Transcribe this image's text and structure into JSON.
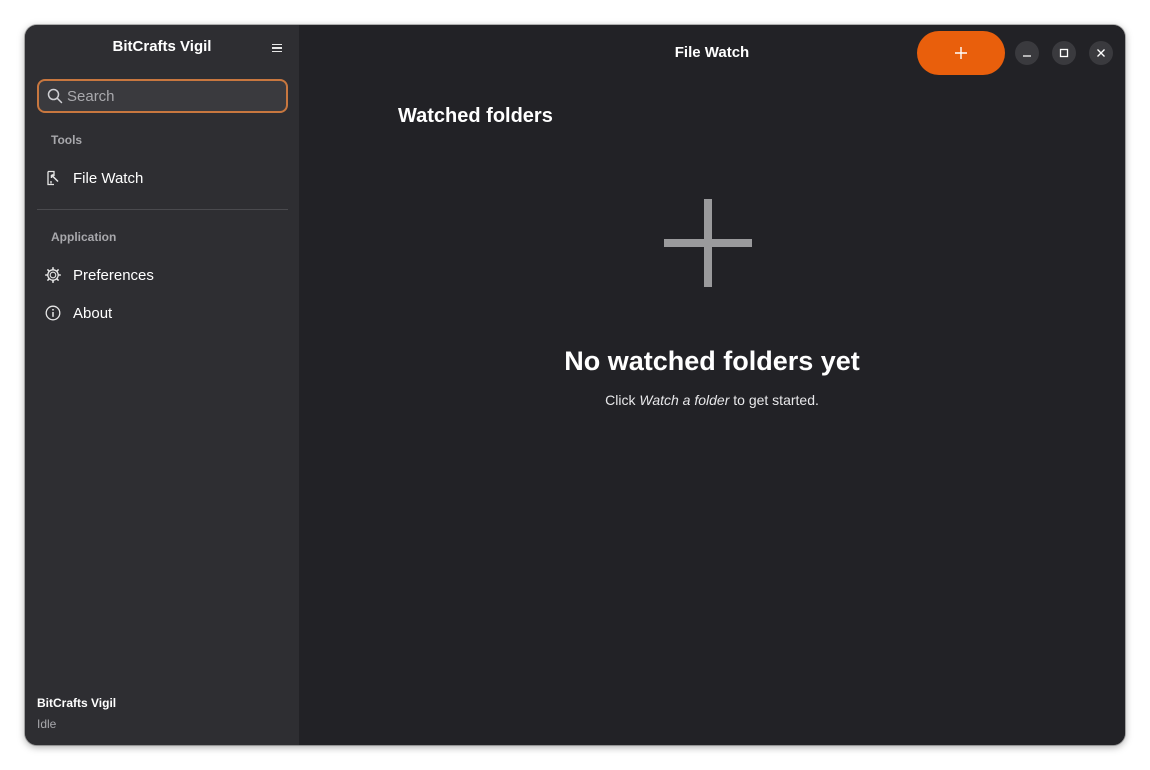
{
  "sidebar": {
    "title": "BitCrafts Vigil",
    "menu_icon": "hamburger-menu-icon",
    "search": {
      "placeholder": "Search",
      "value": ""
    },
    "sections": [
      {
        "label": "Tools",
        "items": [
          {
            "label": "File Watch",
            "icon": "file-watch-icon"
          }
        ]
      },
      {
        "label": "Application",
        "items": [
          {
            "label": "Preferences",
            "icon": "gear-icon"
          },
          {
            "label": "About",
            "icon": "info-icon"
          }
        ]
      }
    ],
    "footer": {
      "title": "BitCrafts Vigil",
      "status": "Idle"
    }
  },
  "main": {
    "title": "File Watch",
    "add_button_icon": "plus-icon",
    "window_controls": [
      "minimize-icon",
      "maximize-icon",
      "close-icon"
    ],
    "section_heading": "Watched folders",
    "empty_state": {
      "icon": "plus-icon",
      "title": "No watched folders yet",
      "desc_prefix": "Click ",
      "desc_emphasis": "Watch a folder",
      "desc_suffix": " to get started."
    }
  },
  "colors": {
    "accent": "#e95f0c",
    "search_border": "#c8773f",
    "sidebar_bg": "#2e2e32",
    "main_bg": "#222226"
  }
}
